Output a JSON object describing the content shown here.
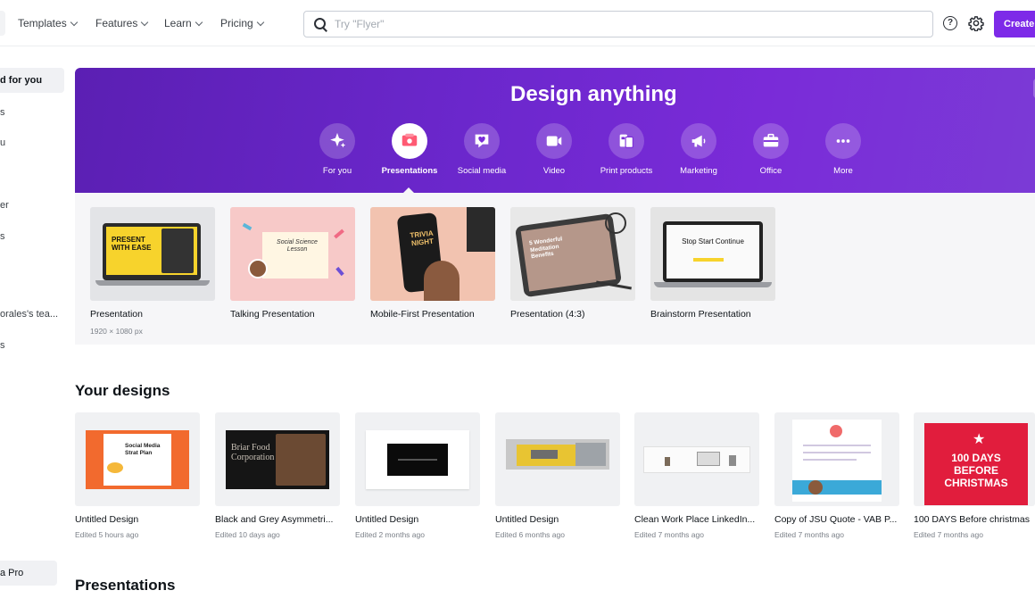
{
  "topbar": {
    "nav": [
      {
        "label": "Templates"
      },
      {
        "label": "Features"
      },
      {
        "label": "Learn"
      },
      {
        "label": "Pricing"
      }
    ],
    "search_placeholder": "Try \"Flyer\"",
    "help_label": "?",
    "create_label": "Create"
  },
  "sidebar": {
    "items": [
      {
        "label": "d for you"
      },
      {
        "label": "s"
      },
      {
        "label": "u"
      },
      {
        "label": "er"
      },
      {
        "label": "s"
      },
      {
        "label": "orales's tea..."
      },
      {
        "label": "s"
      }
    ],
    "pro_label": "a Pro"
  },
  "hero": {
    "title": "Design anything",
    "categories": [
      {
        "label": "For you",
        "icon": "sparkle-icon"
      },
      {
        "label": "Presentations",
        "icon": "presentation-icon"
      },
      {
        "label": "Social media",
        "icon": "heart-chat-icon"
      },
      {
        "label": "Video",
        "icon": "video-camera-icon"
      },
      {
        "label": "Print products",
        "icon": "print-icon"
      },
      {
        "label": "Marketing",
        "icon": "megaphone-icon"
      },
      {
        "label": "Office",
        "icon": "briefcase-icon"
      },
      {
        "label": "More",
        "icon": "more-icon"
      }
    ]
  },
  "templates": [
    {
      "name": "Presentation",
      "dim": "1920 × 1080 px",
      "thumb_text": "PRESENT WITH EASE"
    },
    {
      "name": "Talking Presentation",
      "thumb_text": "Social Science Lesson"
    },
    {
      "name": "Mobile-First Presentation",
      "thumb_text": "TRIVIA NIGHT"
    },
    {
      "name": "Presentation (4:3)",
      "thumb_text": "5 Wonderful Meditation Benefits"
    },
    {
      "name": "Brainstorm Presentation",
      "thumb_text": "Stop Start Continue"
    }
  ],
  "your_designs": {
    "title": "Your designs",
    "items": [
      {
        "name": "Untitled Design",
        "meta": "Edited 5 hours ago",
        "thumb_text": "Social Media Strat Plan"
      },
      {
        "name": "Black and Grey Asymmetri...",
        "meta": "Edited 10 days ago",
        "thumb_text": "Briar Food Corporation"
      },
      {
        "name": "Untitled Design",
        "meta": "Edited 2 months ago"
      },
      {
        "name": "Untitled Design",
        "meta": "Edited 6 months ago"
      },
      {
        "name": "Clean Work Place LinkedIn...",
        "meta": "Edited 7 months ago"
      },
      {
        "name": "Copy of JSU Quote - VAB P...",
        "meta": "Edited 7 months ago"
      },
      {
        "name": "100 DAYS Before christmas",
        "meta": "Edited 7 months ago",
        "thumb_text": "100 DAYS BEFORE CHRISTMAS"
      }
    ]
  },
  "presentations_title": "Presentations",
  "colors": {
    "accent": "#7d2ae8",
    "hero": "#6b27cc"
  }
}
